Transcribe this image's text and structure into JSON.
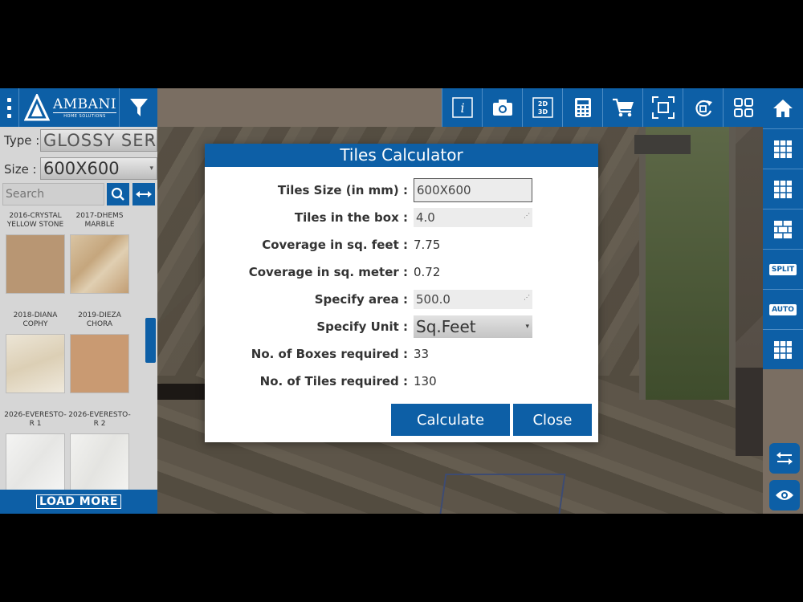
{
  "brand": {
    "name": "AMBANI",
    "tagline": "HOME SOLUTIONS"
  },
  "filters": {
    "type_label": "Type :",
    "type_value": "GLOSSY SERIES",
    "size_label": "Size :",
    "size_value": "600X600",
    "search_placeholder": "Search"
  },
  "tiles": [
    {
      "name": "2016-CRYSTAL YELLOW STONE",
      "color": "#b89673"
    },
    {
      "name": "2017-DHEMS MARBLE",
      "color": "#d1b894"
    },
    {
      "name": "2018-DIANA COPHY",
      "color": "#e4dccb"
    },
    {
      "name": "2019-DIEZA CHORA",
      "color": "#c99a72"
    },
    {
      "name": "2026-EVERESTO-R 1",
      "color": "#f1f1f0"
    },
    {
      "name": "2026-EVERESTO-R 2",
      "color": "#efefed"
    }
  ],
  "load_more": "LOAD MORE",
  "side_tools": {
    "split": "SPLIT",
    "auto": "AUTO"
  },
  "top_tools": {
    "view_2d3d": "2D\n3D"
  },
  "dialog": {
    "title": "Tiles Calculator",
    "rows": [
      {
        "label": "Tiles Size (in mm) :",
        "value": "600X600"
      },
      {
        "label": "Tiles in the box :",
        "value": "4.0"
      },
      {
        "label": "Coverage in sq. feet :",
        "value": "7.75"
      },
      {
        "label": "Coverage in sq. meter :",
        "value": "0.72"
      },
      {
        "label": "Specify area :",
        "value": "500.0"
      },
      {
        "label": "Specify Unit :",
        "value": "Sq.Feet"
      },
      {
        "label": "No. of Boxes required :",
        "value": "33"
      },
      {
        "label": "No. of Tiles required :",
        "value": "130"
      }
    ],
    "calculate": "Calculate",
    "close": "Close"
  },
  "colors": {
    "primary": "#0d5fa6",
    "panel": "#d6d6d6"
  }
}
